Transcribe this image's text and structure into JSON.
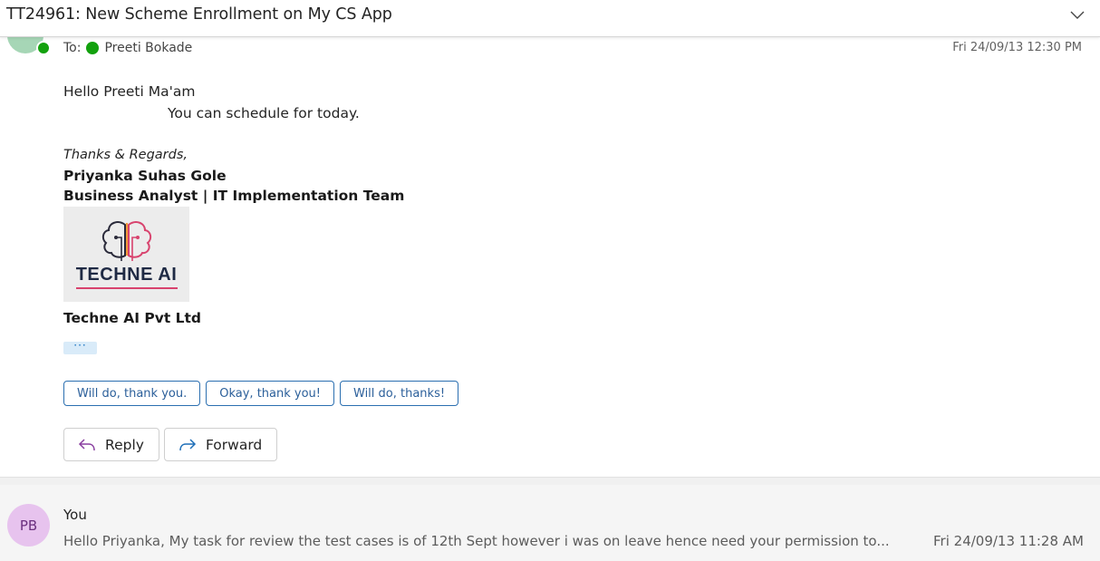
{
  "header": {
    "subject": "TT24961: New Scheme Enrollment on My CS App",
    "expand_icon": "chevron-down-icon"
  },
  "message": {
    "to_label": "To:",
    "recipient": "Preeti Bokade",
    "date": "Fri 24/09/13 12:30 PM",
    "greeting": "Hello Preeti Ma'am",
    "body": "You can schedule for today.",
    "signoff": "Thanks & Regards,",
    "signature_name": "Priyanka Suhas Gole",
    "signature_title": "Business Analyst | IT Implementation Team",
    "logo_text": "TECHNE AI",
    "company": "Techne AI Pvt Ltd",
    "more_label": "···",
    "suggested_replies": [
      "Will do, thank you.",
      "Okay, thank you!",
      "Will do, thanks!"
    ],
    "actions": {
      "reply_label": "Reply",
      "forward_label": "Forward"
    }
  },
  "collapsed_message": {
    "initials": "PB",
    "sender": "You",
    "preview": "Hello Priyanka, My task for review the test cases is of 12th Sept however i was on leave hence need your permission to...",
    "date": "Fri 24/09/13 11:28 AM"
  },
  "colors": {
    "accent": "#0f6cbd",
    "presence_green": "#13a10e",
    "avatar_pb_bg": "#e7c3ee",
    "logo_pink": "#d8436e"
  }
}
